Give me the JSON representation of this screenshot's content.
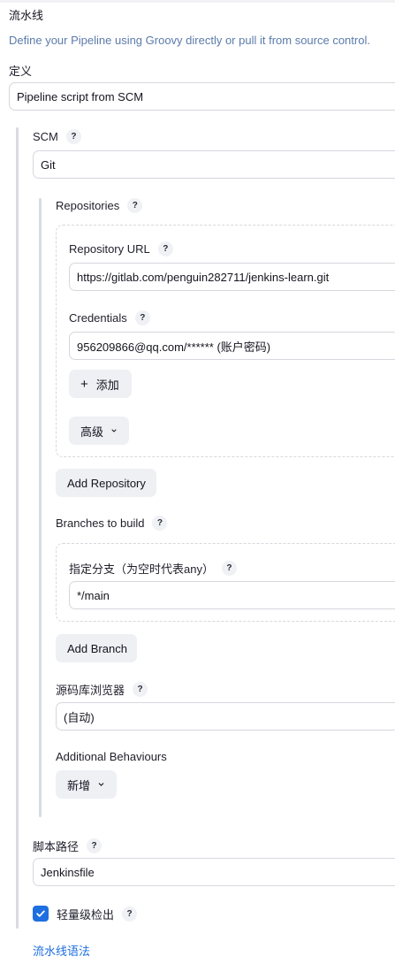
{
  "pipeline": {
    "title": "流水线",
    "description": "Define your Pipeline using Groovy directly or pull it from source control.",
    "definition_label": "定义",
    "definition_value": "Pipeline script from SCM",
    "scm_label": "SCM",
    "scm_value": "Git",
    "repositories_label": "Repositories",
    "repo_url_label": "Repository URL",
    "repo_url_value": "https://gitlab.com/penguin282711/jenkins-learn.git",
    "credentials_label": "Credentials",
    "credentials_value": "956209866@qq.com/****** (账户密码)",
    "add_credential_label": "添加",
    "advanced_label": "高级",
    "add_repository_label": "Add Repository",
    "branches_label": "Branches to build",
    "branch_specifier_label": "指定分支（为空时代表any）",
    "branch_specifier_value": "*/main",
    "add_branch_label": "Add Branch",
    "repo_browser_label": "源码库浏览器",
    "repo_browser_value": "(自动)",
    "additional_behaviours_label": "Additional Behaviours",
    "add_behaviour_label": "新增",
    "script_path_label": "脚本路径",
    "script_path_value": "Jenkinsfile",
    "lightweight_checkout_label": "轻量级检出",
    "lightweight_checkout_checked": true,
    "pipeline_syntax_link": "流水线语法",
    "help_glyph": "?",
    "plus_glyph": "+",
    "accent_color": "#1e6fe0",
    "description_color": "#5b7bab"
  }
}
